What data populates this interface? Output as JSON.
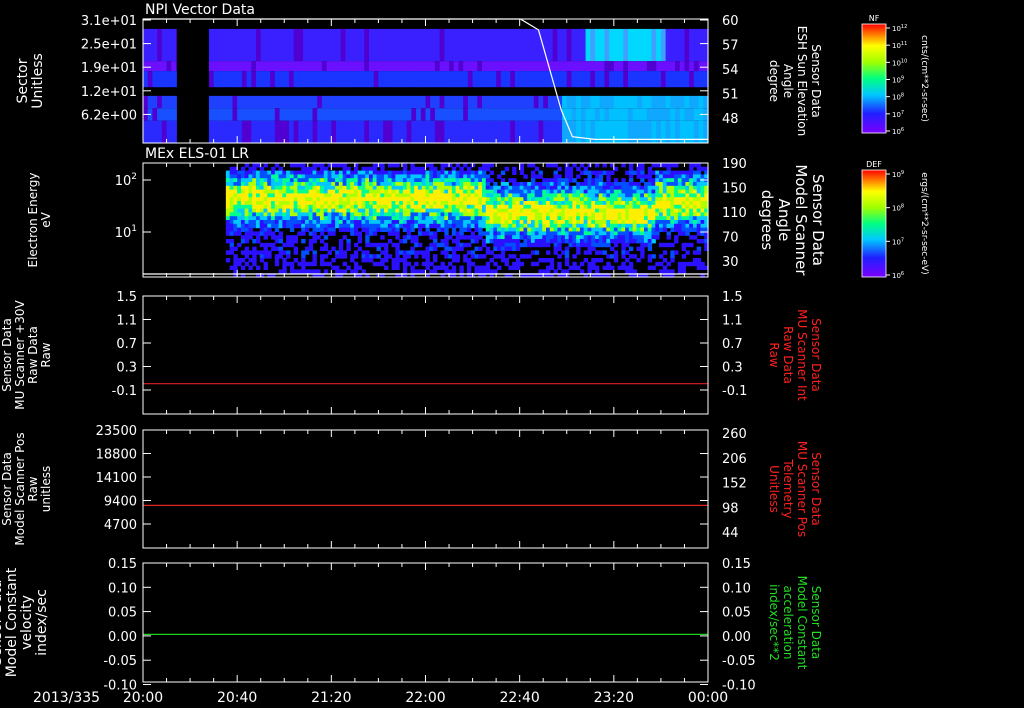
{
  "colors": {
    "background": "#000000",
    "axis": "#ffffff",
    "right_label_red": "#ff2020",
    "right_label_green": "#22dd22",
    "line_red": "#e02020",
    "line_green": "#20d020"
  },
  "time_axis": {
    "start_label": "2013/335",
    "ticks": [
      "20:00",
      "20:40",
      "21:20",
      "22:00",
      "22:40",
      "23:20",
      "00:00"
    ]
  },
  "colorbars": [
    {
      "name": "NF",
      "ticks_exp": [
        "12",
        "11",
        "10",
        "9",
        "8",
        "7",
        "6"
      ],
      "unit": "cnts/(cm**2-sr-sec)"
    },
    {
      "name": "DEF",
      "ticks_exp": [
        "9",
        "8",
        "7",
        "6"
      ],
      "unit": "ergs/(cm**2-sr-sec-eV)"
    }
  ],
  "chart_data": [
    {
      "type": "heatmap",
      "title": "NPI Vector Data",
      "ylabel": [
        "Sector",
        "Unitless"
      ],
      "y_ticks": [
        "3.1e+01",
        "2.5e+01",
        "1.9e+01",
        "1.2e+01",
        "6.2e+00"
      ],
      "right_ylabel": [
        "Sensor Data",
        "ESH Sun Elevation",
        "Angle",
        "degree"
      ],
      "right_ticks": [
        "60",
        "57",
        "54",
        "51",
        "48"
      ],
      "right_ylim": [
        46.3,
        60
      ],
      "overlay_line": {
        "name": "ESH Sun Elevation Angle",
        "points": [
          [
            0,
            60
          ],
          [
            0.668,
            60
          ],
          [
            0.7,
            58.8
          ],
          [
            0.74,
            50
          ],
          [
            0.76,
            47
          ],
          [
            0.8,
            46.7
          ],
          [
            1,
            46.7
          ]
        ]
      },
      "data_gap": [
        0.06,
        0.115
      ]
    },
    {
      "type": "heatmap",
      "title": "MEx ELS-01 LR",
      "ylabel": [
        "Electron Energy",
        "eV"
      ],
      "y_ticks": [
        "10",
        "10"
      ],
      "y_ticks_exp": [
        "2",
        "1"
      ],
      "log_y": true,
      "right_ylabel": [
        "Sensor Data",
        "Model Scanner",
        "Angle",
        "degrees"
      ],
      "right_ticks": [
        "190",
        "150",
        "110",
        "70",
        "30"
      ],
      "right_ylim": [
        0,
        190
      ],
      "overlay_line": {
        "name": "Model Scanner Angle",
        "points": [
          [
            0,
            5
          ],
          [
            1,
            5
          ]
        ]
      },
      "data_start": 0.145
    },
    {
      "type": "line",
      "ylabel": [
        "Sensor Data",
        "MU Scanner +30V",
        "Raw Data",
        "Raw"
      ],
      "y_ticks": [
        "1.5",
        "1.1",
        "0.7",
        "0.3",
        "-0.1"
      ],
      "ylim": [
        -0.45,
        1.5
      ],
      "right_ylabel": [
        "Sensor Data",
        "MU Scanner Int",
        "Raw Data",
        "Raw"
      ],
      "right_ticks": [
        "1.5",
        "1.1",
        "0.7",
        "0.3",
        "-0.1"
      ],
      "series": [
        {
          "x": [
            0,
            1
          ],
          "y": [
            0.05,
            0.05
          ]
        }
      ]
    },
    {
      "type": "line",
      "ylabel": [
        "Sensor Data",
        "Model Scanner Pos",
        "Raw",
        "unitless"
      ],
      "y_ticks": [
        "23500",
        "18800",
        "14100",
        "9400",
        "4700"
      ],
      "ylim": [
        -600,
        23500
      ],
      "right_ylabel": [
        "Sensor Data",
        "MU Scanner Pos",
        "Telemetry",
        "Unitless"
      ],
      "right_ticks": [
        "260",
        "206",
        "152",
        "98",
        "44"
      ],
      "series": [
        {
          "x": [
            0,
            1
          ],
          "y": [
            8100,
            8100
          ]
        }
      ]
    },
    {
      "type": "line",
      "ylabel": [
        "Sensor Data",
        "Model Constant",
        "velocity",
        "index/sec"
      ],
      "y_ticks": [
        "0.15",
        "0.10",
        "0.05",
        "0.00",
        "-0.05",
        "-0.10"
      ],
      "ylim": [
        -0.1,
        0.15
      ],
      "right_ylabel": [
        "Sensor Data",
        "Model Constant",
        "acceleration",
        "index/sec**2"
      ],
      "right_ticks": [
        "0.15",
        "0.10",
        "0.05",
        "0.00",
        "-0.05",
        "-0.10"
      ],
      "series": [
        {
          "x": [
            0,
            1
          ],
          "y": [
            0.0,
            0.0
          ]
        }
      ]
    }
  ]
}
